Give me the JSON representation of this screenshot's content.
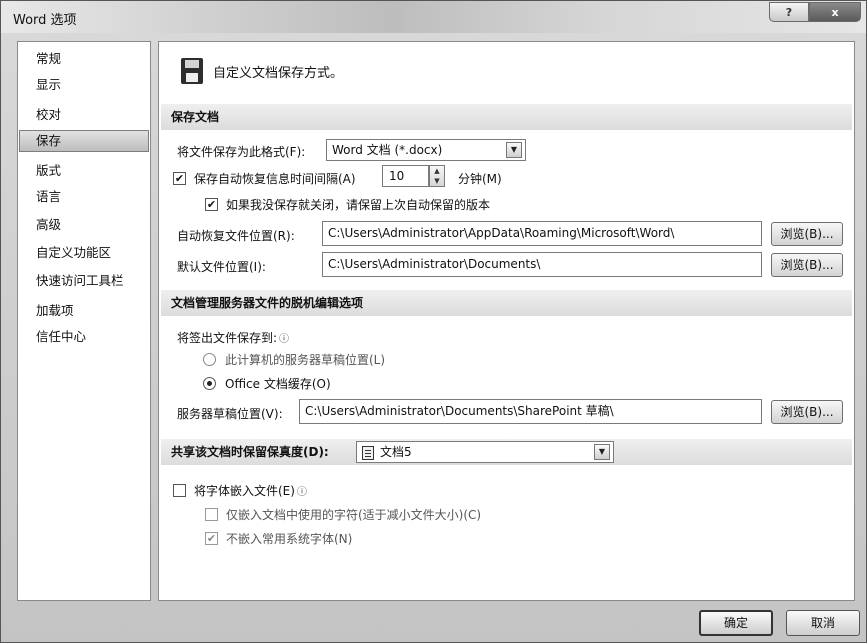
{
  "window": {
    "title": "Word 选项",
    "help_glyph": "?",
    "close_glyph": "x"
  },
  "sidebar": {
    "items": [
      {
        "label": "常规"
      },
      {
        "label": "显示"
      },
      {
        "label": "校对"
      },
      {
        "label": "保存"
      },
      {
        "label": "版式"
      },
      {
        "label": "语言"
      },
      {
        "label": "高级"
      },
      {
        "label": "自定义功能区"
      },
      {
        "label": "快速访问工具栏"
      },
      {
        "label": "加载项"
      },
      {
        "label": "信任中心"
      }
    ],
    "selected": "保存"
  },
  "header": {
    "icon": "floppy-disk-icon",
    "text": "自定义文档保存方式。"
  },
  "save_docs": {
    "section_title": "保存文档",
    "format_label": "将文件保存为此格式(F):",
    "format_value": "Word 文档 (*.docx)",
    "autorecover_label": "保存自动恢复信息时间间隔(A)",
    "autorecover_checked": true,
    "autorecover_minutes": "10",
    "minutes_label": "分钟(M)",
    "keep_last_label": "如果我没保存就关闭，请保留上次自动保留的版本",
    "keep_last_checked": true,
    "autorecover_location_label": "自动恢复文件位置(R):",
    "autorecover_location_value": "C:\\Users\\Administrator\\AppData\\Roaming\\Microsoft\\Word\\",
    "default_location_label": "默认文件位置(I):",
    "default_location_value": "C:\\Users\\Administrator\\Documents\\",
    "browse_label": "浏览(B)..."
  },
  "offline": {
    "section_title": "文档管理服务器文件的脱机编辑选项",
    "save_checked_out_label": "将签出文件保存到:",
    "option_server_drafts": "此计算机的服务器草稿位置(L)",
    "option_office_cache": "Office 文档缓存(O)",
    "selected_option": "Office 文档缓存(O)",
    "server_drafts_label": "服务器草稿位置(V):",
    "server_drafts_value": "C:\\Users\\Administrator\\Documents\\SharePoint 草稿\\",
    "browse_label": "浏览(B)..."
  },
  "fidelity": {
    "section_title": "共享该文档时保留保真度(D):",
    "document_value": "文档5",
    "embed_fonts_label": "将字体嵌入文件(E)",
    "embed_fonts_checked": false,
    "embed_used_chars_label": "仅嵌入文档中使用的字符(适于减小文件大小)(C)",
    "embed_used_chars_checked": false,
    "no_common_fonts_label": "不嵌入常用系统字体(N)",
    "no_common_fonts_checked": true
  },
  "footer": {
    "ok_label": "确定",
    "cancel_label": "取消"
  }
}
